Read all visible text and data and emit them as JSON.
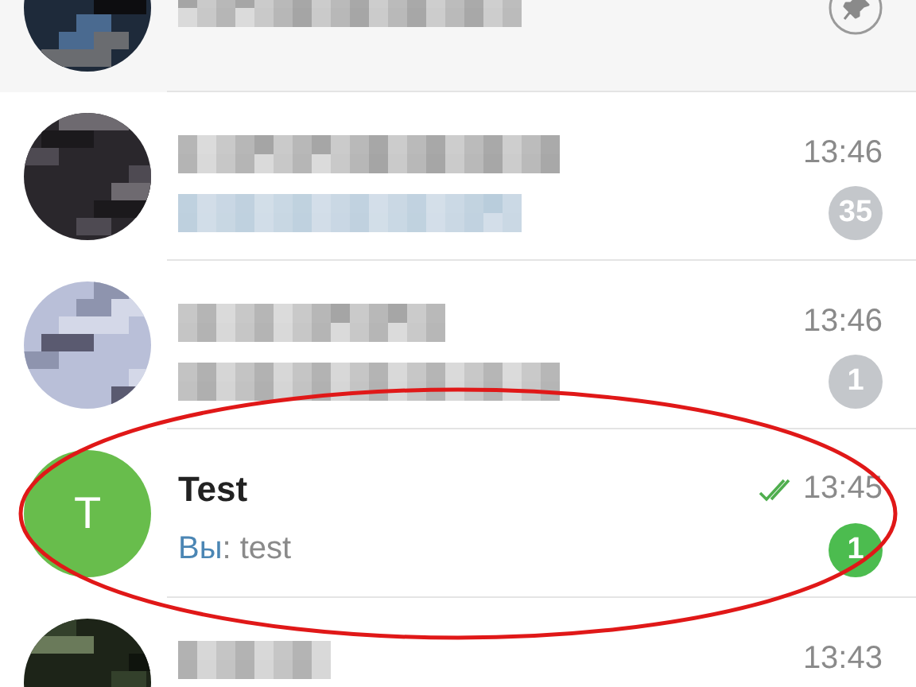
{
  "chats": [
    {
      "kind": "blurred",
      "pinned": true,
      "circled": false
    },
    {
      "kind": "blurred",
      "pinned": false,
      "time": "13:46",
      "unread": "35",
      "muted": true,
      "circled": false
    },
    {
      "kind": "blurred",
      "pinned": false,
      "time": "13:46",
      "unread": "1",
      "muted": true,
      "circled": false
    },
    {
      "kind": "plain",
      "pinned": false,
      "avatar_letter": "T",
      "name": "Test",
      "read": true,
      "time": "13:45",
      "sender": "Вы",
      "message": ": test",
      "unread": "1",
      "muted": false,
      "circled": true
    },
    {
      "kind": "blurred",
      "pinned": false,
      "time": "13:43",
      "circled": false
    }
  ]
}
